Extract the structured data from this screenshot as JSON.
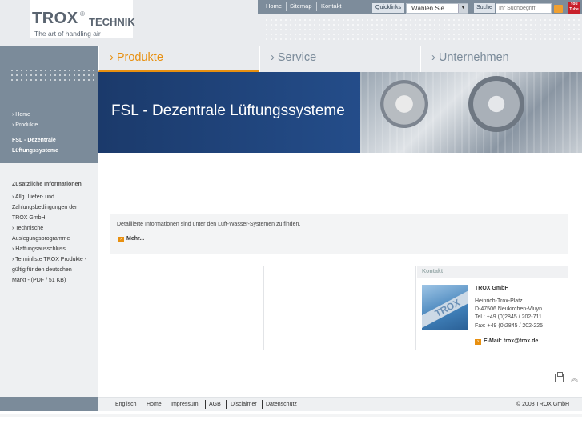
{
  "logo": {
    "brand": "TROX",
    "brand_suffix": "TECHNIK",
    "tagline": "The art of handling air",
    "registered": "®"
  },
  "topbar": {
    "links": [
      "Home",
      "Sitemap",
      "Kontakt"
    ],
    "quicklinks_label": "Quicklinks",
    "quicklinks_value": "Wählen Sie",
    "search_label": "Suche",
    "search_placeholder": "Ihr Suchbegriff",
    "youtube_text": "You Tube"
  },
  "main_nav": [
    {
      "label": "› Produkte",
      "active": true
    },
    {
      "label": "› Service",
      "active": false
    },
    {
      "label": "› Unternehmen",
      "active": false
    }
  ],
  "breadcrumb": {
    "items": [
      "› Home",
      "› Produkte"
    ],
    "current": [
      "FSL - Dezentrale",
      "Lüftungssysteme"
    ]
  },
  "sidebar": {
    "title": "Zusätzliche Informationen",
    "links": [
      [
        "› Allg. Liefer- und",
        "Zahlungsbedingungen der",
        "TROX GmbH"
      ],
      [
        "› Technische",
        "Auslegungsprogramme"
      ],
      [
        "› Haftungsausschluss"
      ],
      [
        "› Terminliste TROX Produkte -",
        "gültig für den deutschen",
        "Markt - (PDF / 51 KB)"
      ]
    ]
  },
  "banner": {
    "title": "FSL - Dezentrale Lüftungssysteme"
  },
  "content": {
    "text": "Detaillierte Informationen sind unter den Luft-Wasser-Systemen zu finden.",
    "more_label": "Mehr..."
  },
  "kontakt": {
    "title": "Kontakt",
    "image_text": "TROX",
    "company": "TROX GmbH",
    "address_lines": [
      "Heinrich-Trox-Platz",
      "D-47506 Neukirchen-Vluyn",
      "Tel.: +49 (0)2845 / 202-711",
      "Fax: +49 (0)2845 / 202-225"
    ],
    "email_label": "E-Mail: trox@trox.de"
  },
  "footer": {
    "links": [
      "Englisch",
      "Home",
      "Impressum",
      "AGB",
      "Disclaimer",
      "Datenschutz"
    ],
    "copyright": "© 2008 TROX GmbH"
  },
  "colors": {
    "accent": "#e89010",
    "nav_grey": "#7b8b9a",
    "banner_blue": "#1b3a6b"
  }
}
